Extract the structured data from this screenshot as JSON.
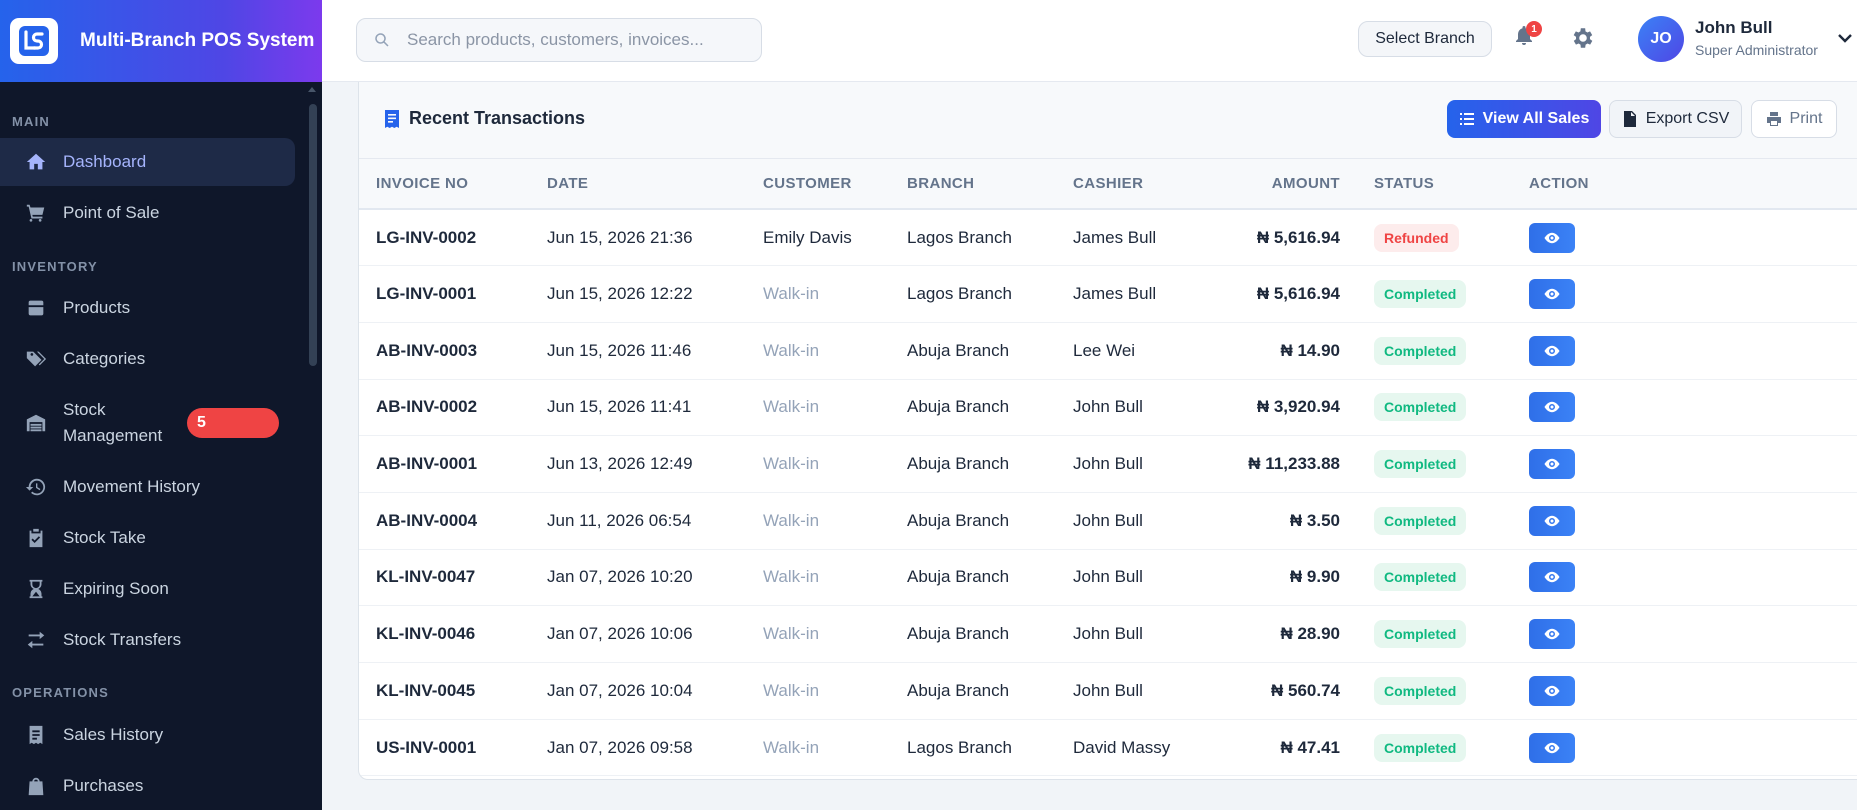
{
  "app": {
    "title": "Multi-Branch POS System",
    "logo_icon": "pos-logo-icon"
  },
  "sidebar": {
    "sections": [
      {
        "label": "MAIN"
      },
      {
        "label": "INVENTORY"
      },
      {
        "label": "OPERATIONS"
      }
    ],
    "items": [
      {
        "label": "Dashboard",
        "icon": "home-icon",
        "active": true
      },
      {
        "label": "Point of Sale",
        "icon": "cart-icon"
      },
      {
        "label": "Products",
        "icon": "box-icon"
      },
      {
        "label": "Categories",
        "icon": "tags-icon"
      },
      {
        "label": "Stock Management",
        "icon": "warehouse-icon",
        "badge": "5"
      },
      {
        "label": "Movement History",
        "icon": "history-icon"
      },
      {
        "label": "Stock Take",
        "icon": "clipboard-check-icon"
      },
      {
        "label": "Expiring Soon",
        "icon": "hourglass-icon"
      },
      {
        "label": "Stock Transfers",
        "icon": "transfer-arrows-icon"
      },
      {
        "label": "Sales History",
        "icon": "receipt-icon"
      },
      {
        "label": "Purchases",
        "icon": "shopping-bag-icon"
      }
    ]
  },
  "header": {
    "search_placeholder": "Search products, customers, invoices...",
    "branch_button": "Select Branch",
    "notification_count": "1",
    "user": {
      "initials": "JO",
      "name": "John Bull",
      "role": "Super Administrator"
    }
  },
  "transactions": {
    "title": "Recent Transactions",
    "buttons": {
      "view_all": "View All Sales",
      "export": "Export CSV",
      "print": "Print"
    },
    "columns": [
      "INVOICE NO",
      "DATE",
      "CUSTOMER",
      "BRANCH",
      "CASHIER",
      "AMOUNT",
      "STATUS",
      "ACTION"
    ],
    "rows": [
      {
        "invoice": "LG-INV-0002",
        "date": "Jun 15, 2026 21:36",
        "customer": "Emily Davis",
        "branch": "Lagos Branch",
        "cashier": "James Bull",
        "amount": "₦ 5,616.94",
        "status": "Refunded"
      },
      {
        "invoice": "LG-INV-0001",
        "date": "Jun 15, 2026 12:22",
        "customer": "Walk-in",
        "branch": "Lagos Branch",
        "cashier": "James Bull",
        "amount": "₦ 5,616.94",
        "status": "Completed"
      },
      {
        "invoice": "AB-INV-0003",
        "date": "Jun 15, 2026 11:46",
        "customer": "Walk-in",
        "branch": "Abuja Branch",
        "cashier": "Lee Wei",
        "amount": "₦ 14.90",
        "status": "Completed"
      },
      {
        "invoice": "AB-INV-0002",
        "date": "Jun 15, 2026 11:41",
        "customer": "Walk-in",
        "branch": "Abuja Branch",
        "cashier": "John Bull",
        "amount": "₦ 3,920.94",
        "status": "Completed"
      },
      {
        "invoice": "AB-INV-0001",
        "date": "Jun 13, 2026 12:49",
        "customer": "Walk-in",
        "branch": "Abuja Branch",
        "cashier": "John Bull",
        "amount": "₦ 11,233.88",
        "status": "Completed"
      },
      {
        "invoice": "AB-INV-0004",
        "date": "Jun 11, 2026 06:54",
        "customer": "Walk-in",
        "branch": "Abuja Branch",
        "cashier": "John Bull",
        "amount": "₦ 3.50",
        "status": "Completed"
      },
      {
        "invoice": "KL-INV-0047",
        "date": "Jan 07, 2026 10:20",
        "customer": "Walk-in",
        "branch": "Abuja Branch",
        "cashier": "John Bull",
        "amount": "₦ 9.90",
        "status": "Completed"
      },
      {
        "invoice": "KL-INV-0046",
        "date": "Jan 07, 2026 10:06",
        "customer": "Walk-in",
        "branch": "Abuja Branch",
        "cashier": "John Bull",
        "amount": "₦ 28.90",
        "status": "Completed"
      },
      {
        "invoice": "KL-INV-0045",
        "date": "Jan 07, 2026 10:04",
        "customer": "Walk-in",
        "branch": "Abuja Branch",
        "cashier": "John Bull",
        "amount": "₦ 560.74",
        "status": "Completed"
      },
      {
        "invoice": "US-INV-0001",
        "date": "Jan 07, 2026 09:58",
        "customer": "Walk-in",
        "branch": "Lagos Branch",
        "cashier": "David Massy",
        "amount": "₦ 47.41",
        "status": "Completed"
      }
    ]
  },
  "colors": {
    "brand_blue": "#2563eb",
    "brand_indigo": "#4f46e5",
    "sidebar_bg": "#0f172a",
    "status_completed": "#10b981",
    "status_refunded": "#ef4444"
  }
}
